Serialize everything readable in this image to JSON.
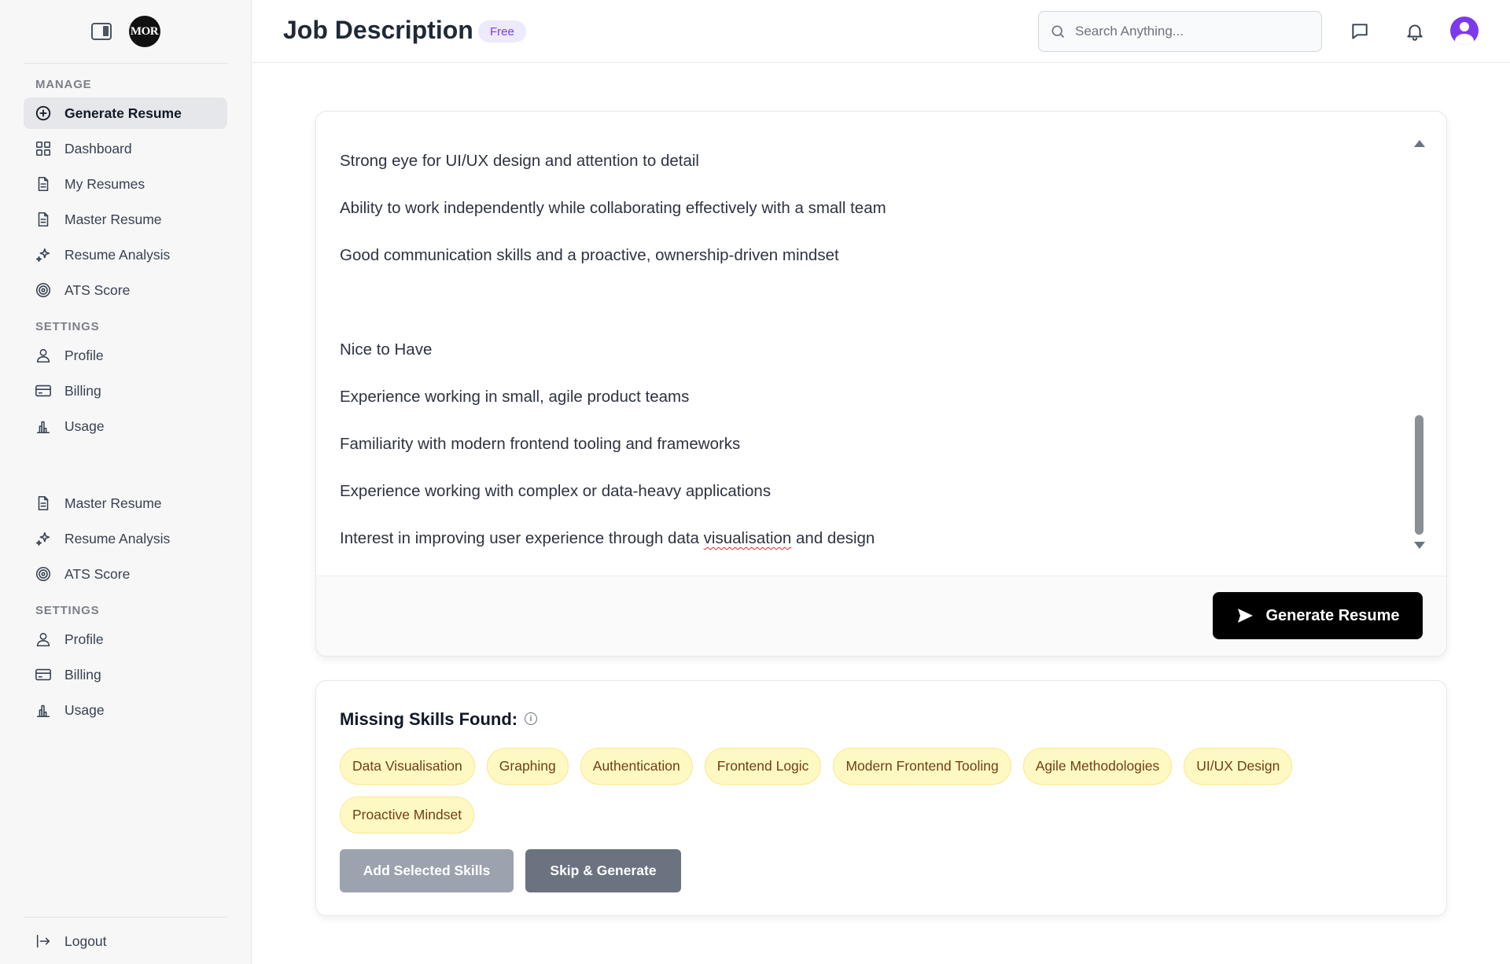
{
  "sidebar": {
    "logo_text": "MOR",
    "sections": [
      {
        "label": "MANAGE",
        "items": [
          {
            "label": "Generate Resume",
            "icon": "plus-circle-icon",
            "active": true
          },
          {
            "label": "Dashboard",
            "icon": "grid-icon"
          },
          {
            "label": "My Resumes",
            "icon": "document-icon"
          },
          {
            "label": "Master Resume",
            "icon": "document-icon"
          },
          {
            "label": "Resume Analysis",
            "icon": "sparkles-icon"
          },
          {
            "label": "ATS Score",
            "icon": "target-icon"
          }
        ]
      },
      {
        "label": "SETTINGS",
        "items": [
          {
            "label": "Profile",
            "icon": "user-icon"
          },
          {
            "label": "Billing",
            "icon": "credit-card-icon"
          },
          {
            "label": "Usage",
            "icon": "bar-chart-icon"
          }
        ]
      },
      {
        "label": "",
        "items": [
          {
            "label": "Master Resume",
            "icon": "document-icon"
          },
          {
            "label": "Resume Analysis",
            "icon": "sparkles-icon"
          },
          {
            "label": "ATS Score",
            "icon": "target-icon"
          }
        ]
      },
      {
        "label": "SETTINGS",
        "items": [
          {
            "label": "Profile",
            "icon": "user-icon"
          },
          {
            "label": "Billing",
            "icon": "credit-card-icon"
          },
          {
            "label": "Usage",
            "icon": "bar-chart-icon"
          }
        ]
      }
    ],
    "logout_label": "Logout"
  },
  "header": {
    "title": "Job Description",
    "badge": "Free",
    "search_placeholder": "Search Anything..."
  },
  "job_description": {
    "lines": [
      {
        "text": "Strong eye for UI/UX design and attention to detail"
      },
      {
        "text": "Ability to work independently while collaborating effectively with a small team"
      },
      {
        "text": "Good communication skills and a proactive, ownership-driven mindset"
      },
      {
        "text": "Nice to Have"
      },
      {
        "text": "Experience working in small, agile product teams"
      },
      {
        "text": "Familiarity with modern frontend tooling and frameworks"
      },
      {
        "text": "Experience working with complex or data-heavy applications"
      },
      {
        "text": "Interest in improving user experience through data visualisation and design",
        "misspelled": "visualisation"
      }
    ],
    "generate_button": "Generate Resume"
  },
  "missing_skills": {
    "title": "Missing Skills Found:",
    "skills": [
      "Data Visualisation",
      "Graphing",
      "Authentication",
      "Frontend Logic",
      "Modern Frontend Tooling",
      "Agile Methodologies",
      "UI/UX Design",
      "Proactive Mindset"
    ],
    "add_button": "Add Selected Skills",
    "skip_button": "Skip & Generate"
  },
  "colors": {
    "accent": "#7c3aed",
    "chip_bg": "#fef9c3",
    "chip_border": "#fde68a",
    "primary_button": "#000000"
  }
}
